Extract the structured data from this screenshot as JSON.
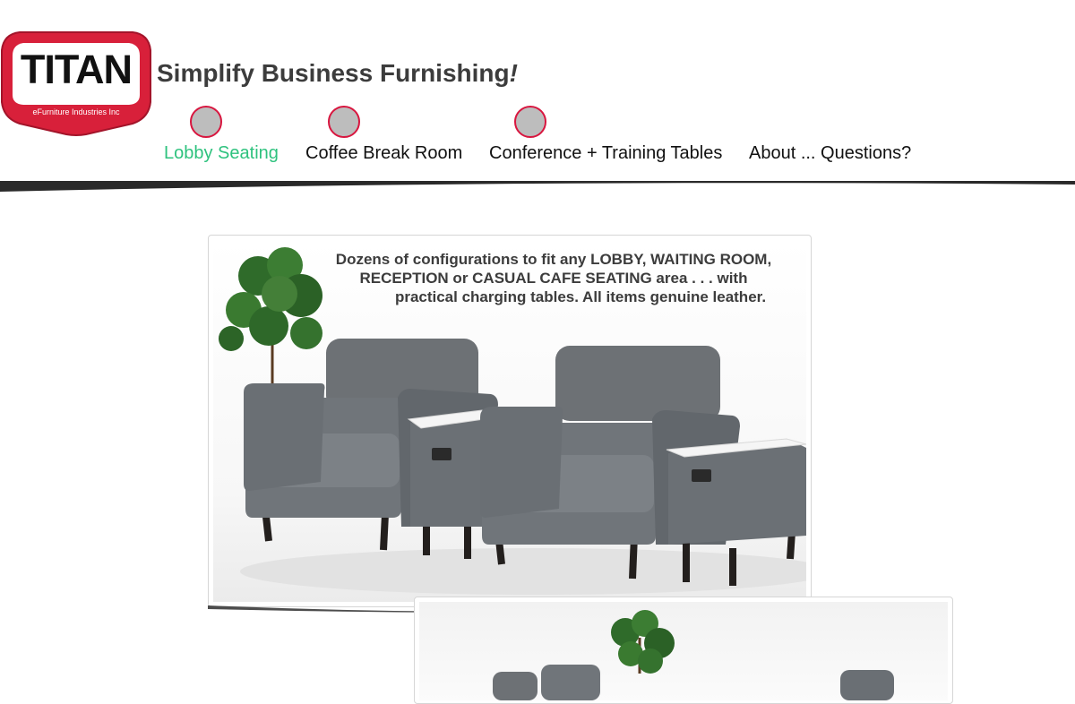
{
  "brand": {
    "name": "TITAN",
    "subtitle": "eFurniture Industries Inc",
    "colors": {
      "badge_red": "#d8203a",
      "badge_border": "#a3142a",
      "accent_green": "#2ec27e",
      "nav_dot": "#bdbdbd",
      "nav_dot_border": "#d8163f"
    }
  },
  "header": {
    "tagline": "Simplify Business Furnishing",
    "tagline_mark": "!"
  },
  "nav": {
    "items": [
      {
        "label": "Lobby Seating",
        "active": true
      },
      {
        "label": "Coffee Break Room",
        "active": false
      },
      {
        "label": "Conference + Training Tables",
        "active": false
      },
      {
        "label": "About ... Questions?",
        "active": false
      }
    ]
  },
  "main_card": {
    "caption_lines": [
      "Dozens of configurations to fit any LOBBY, WAITING ROOM,",
      "RECEPTION or CASUAL CAFE SEATING area . . . with",
      "practical charging tables.  All items genuine leather."
    ],
    "image": "photo of two gray leather lounge chairs with charging side tables and a potted plant"
  },
  "second_card": {
    "image": "photo of gray leather lounge seating with a potted plant"
  }
}
